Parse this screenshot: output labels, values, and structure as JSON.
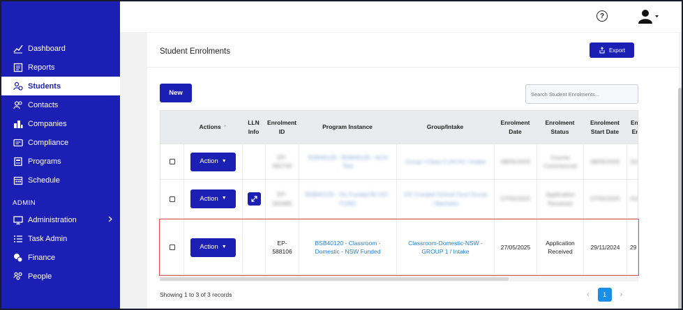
{
  "sidebar": {
    "items": [
      {
        "label": "Dashboard",
        "icon": "chart-line-icon"
      },
      {
        "label": "Reports",
        "icon": "report-icon"
      },
      {
        "label": "Students",
        "icon": "students-icon",
        "active": true
      },
      {
        "label": "Contacts",
        "icon": "contacts-icon"
      },
      {
        "label": "Companies",
        "icon": "building-icon"
      },
      {
        "label": "Compliance",
        "icon": "id-card-icon"
      },
      {
        "label": "Programs",
        "icon": "programs-icon"
      },
      {
        "label": "Schedule",
        "icon": "calendar-icon"
      }
    ],
    "section_admin": "ADMIN",
    "admin_items": [
      {
        "label": "Administration",
        "icon": "monitor-icon"
      },
      {
        "label": "Task Admin",
        "icon": "list-icon"
      },
      {
        "label": "Finance",
        "icon": "coins-icon"
      },
      {
        "label": "People",
        "icon": "people-icon"
      }
    ]
  },
  "topbar": {
    "help_glyph": "?"
  },
  "card": {
    "title": "Student Enrolments",
    "export_label": "Export",
    "new_label": "New",
    "search_placeholder": "Search Student Enrolments..."
  },
  "table": {
    "headers": {
      "actions": "Actions",
      "sort_glyph": "^",
      "lln_line1": "LLN",
      "lln_line2": "Info",
      "enrol_id_line1": "Enrolment",
      "enrol_id_line2": "ID",
      "program": "Program Instance",
      "group": "Group/Intake",
      "enrol_date_line1": "Enrolment",
      "enrol_date_line2": "Date",
      "enrol_status_line1": "Enrolment",
      "enrol_status_line2": "Status",
      "start_date_line1": "Enrolment",
      "start_date_line2": "Start Date",
      "end_line1": "Enr",
      "end_line2": "En"
    },
    "action_label": "Action",
    "rows": [
      {
        "id_line1": "EP-",
        "id_line2": "582745",
        "program_line1": "BSB40120 - BSB40120 - ACH",
        "program_line2": "Test",
        "group_line1": "Group / Class 5 (ACH) / Intake",
        "group_line2": "",
        "enrol_date": "08/05/2025",
        "status_line1": "Course",
        "status_line2": "Commenced",
        "start_date": "08/05/2025",
        "end": "31/0"
      },
      {
        "id_line1": "EP-",
        "id_line2": "583485",
        "program_line1": "BSB40120 - Vic Funded BI-VIC-",
        "program_line2": "FUND",
        "group_line1": "VIC Funded School Govt Group",
        "group_line2": "/ Bachelor",
        "enrol_date": "07/05/2025",
        "status_line1": "Application",
        "status_line2": "Received",
        "start_date": "07/05/2025",
        "end": "31/0"
      },
      {
        "id_line1": "EP-",
        "id_line2": "588106",
        "program_line1": "BSB40120 - Classroom -",
        "program_line2": "Domestic - NSW Funded",
        "group_line1": "Classroom-Domestic-NSW -",
        "group_line2": "GROUP 1 / Intake",
        "enrol_date": "27/05/2025",
        "status_line1": "Application",
        "status_line2": "Received",
        "start_date": "29/11/2024",
        "end": "29"
      }
    ]
  },
  "footer": {
    "showing": "Showing 1 to 3 of 3 records",
    "prev_glyph": "‹",
    "page": "1",
    "next_glyph": "›"
  },
  "colors": {
    "brand": "#1c1fb3",
    "link": "#1f7fd8",
    "highlight": "#e05050"
  }
}
